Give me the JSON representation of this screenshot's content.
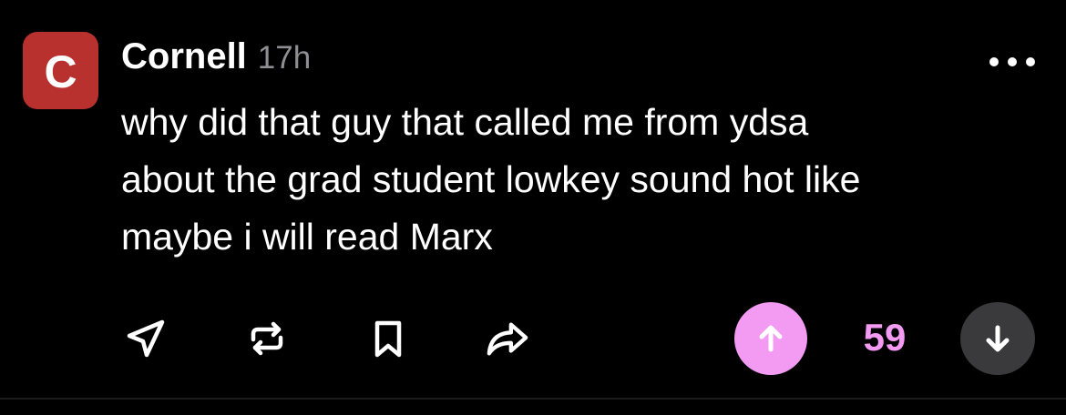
{
  "post": {
    "avatar_letter": "C",
    "avatar_color": "#b8312f",
    "author": "Cornell",
    "timestamp": "17h",
    "body_lines": [
      "why did that guy that called me from ydsa",
      "about the grad student lowkey sound hot like",
      "maybe i will read Marx"
    ]
  },
  "menu": {
    "icon": "more-horizontal-icon"
  },
  "actions": {
    "items": [
      {
        "name": "share",
        "icon": "send-icon"
      },
      {
        "name": "repost",
        "icon": "repost-icon"
      },
      {
        "name": "bookmark",
        "icon": "bookmark-icon"
      },
      {
        "name": "forward",
        "icon": "forward-icon"
      }
    ],
    "score": "59",
    "upvote_color": "#f39af3",
    "downvote_color": "#3a3a3c"
  }
}
